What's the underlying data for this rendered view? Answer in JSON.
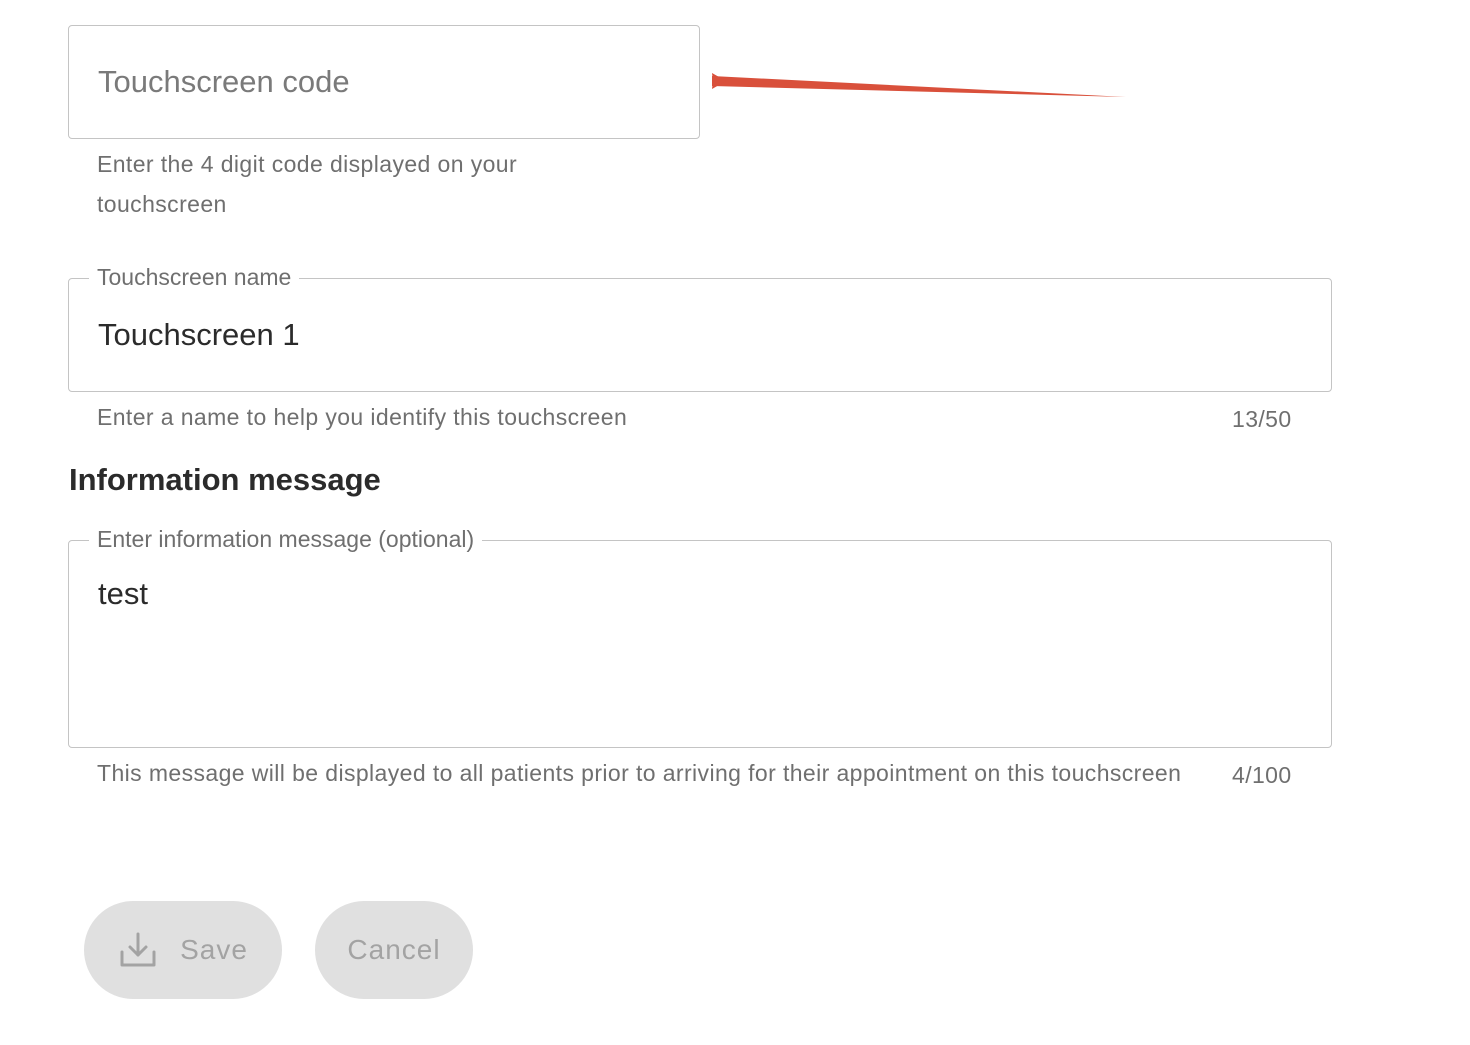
{
  "code_field": {
    "placeholder": "Touchscreen code",
    "helper": "Enter the 4 digit code displayed on your touchscreen"
  },
  "name_field": {
    "label": "Touchscreen name",
    "value": "Touchscreen 1",
    "helper": "Enter a name to help you identify this touchscreen",
    "counter": "13/50"
  },
  "info_section": {
    "title": "Information message"
  },
  "message_field": {
    "label": "Enter information message (optional)",
    "value": "test",
    "helper": "This message will be displayed to all patients prior to arriving for their appointment on this touchscreen",
    "counter": "4/100"
  },
  "actions": {
    "save_label": "Save",
    "save_icon": "download-icon",
    "cancel_label": "Cancel"
  },
  "colors": {
    "annotation_arrow": "#d9503b",
    "button_bg": "#e0e0e0",
    "button_text": "#a3a3a3",
    "border": "#c4c4c4"
  }
}
